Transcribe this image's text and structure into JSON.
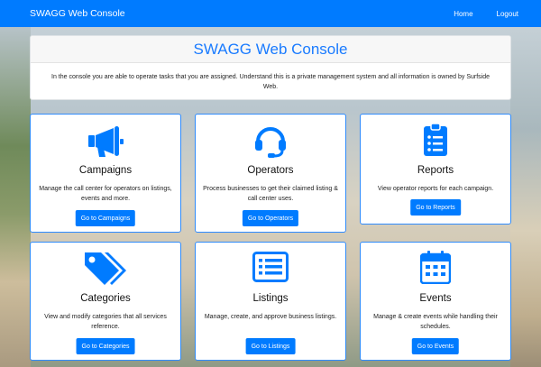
{
  "navbar": {
    "brand": "SWAGG Web Console",
    "links": [
      "Home",
      "Logout"
    ]
  },
  "header": {
    "title": "SWAGG Web Console",
    "text": "In the console you are able to operate tasks that you are assigned. Understand this is a private management system and all information is owned by Surfside Web."
  },
  "cards": [
    {
      "icon": "megaphone-icon",
      "title": "Campaigns",
      "desc": "Manage the call center for operators on listings, events and more.",
      "button": "Go to Campaigns"
    },
    {
      "icon": "headset-icon",
      "title": "Operators",
      "desc": "Process businesses to get their claimed listing & call center uses.",
      "button": "Go to Operators"
    },
    {
      "icon": "clipboard-list-icon",
      "title": "Reports",
      "desc": "View operator reports for each campaign.",
      "button": "Go to Reports"
    },
    {
      "icon": "tags-icon",
      "title": "Categories",
      "desc": "View and modify categories that all services reference.",
      "button": "Go to Categories"
    },
    {
      "icon": "list-alt-icon",
      "title": "Listings",
      "desc": "Manage, create, and approve business listings.",
      "button": "Go to Listings"
    },
    {
      "icon": "calendar-icon",
      "title": "Events",
      "desc": "Manage & create events while handling their schedules.",
      "button": "Go to Events"
    }
  ],
  "colors": {
    "primary": "#007bff",
    "card_border": "#2f8bff"
  }
}
